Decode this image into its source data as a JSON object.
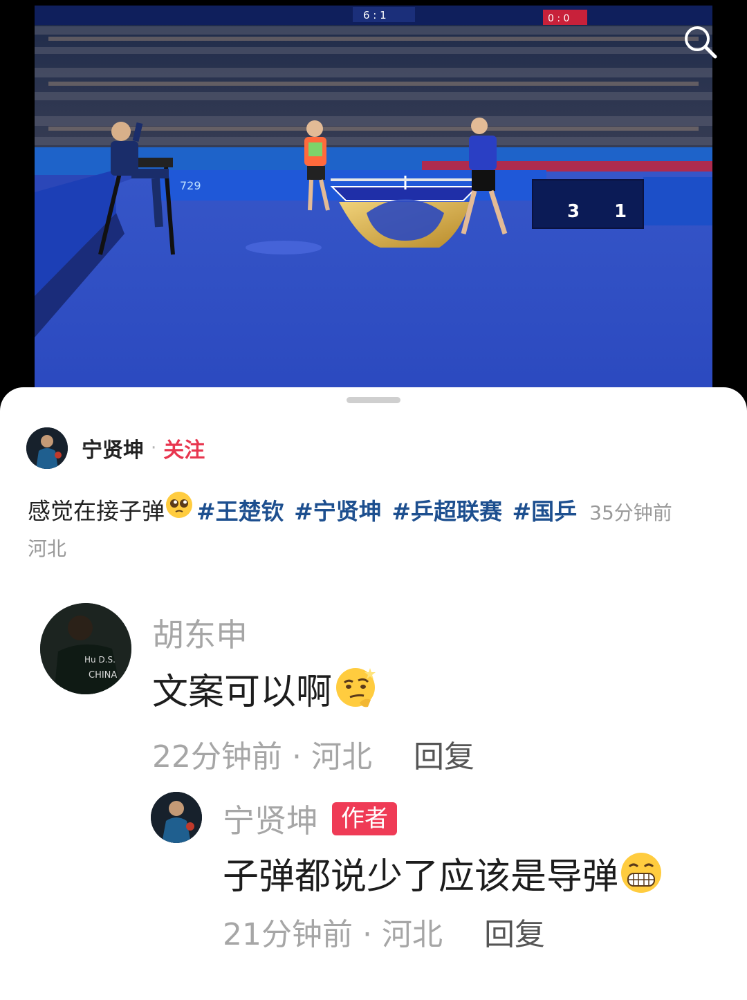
{
  "media": {
    "scoreboard_left": "3",
    "scoreboard_right": "1",
    "banner_top_score": "6 : 1",
    "banner_mid_score": "0 : 0",
    "sponsor_text": "729"
  },
  "post": {
    "username": "宁贤坤",
    "separator": "·",
    "follow_label": "关注",
    "caption_text": "感觉在接子弹",
    "hashtags": [
      "#王楚钦",
      "#宁贤坤",
      "#乒超联赛",
      "#国乒"
    ],
    "time": "35分钟前",
    "location": "河北"
  },
  "comments": [
    {
      "username": "胡东申",
      "text": "文案可以啊",
      "meta": "22分钟前 · 河北",
      "reply_label": "回复",
      "avatar_jersey_text": "Hu D.S.",
      "avatar_jersey_text2": "CHINA",
      "emoji_icon": "smirk-thinking-emoji"
    }
  ],
  "replies": [
    {
      "username": "宁贤坤",
      "badge": "作者",
      "text": "子弹都说少了应该是导弹",
      "meta": "21分钟前 · 河北",
      "reply_label": "回复",
      "emoji_icon": "grinning-teeth-emoji"
    }
  ],
  "colors": {
    "accent_red": "#e8364f",
    "hashtag_blue": "#1d4f8f",
    "badge_red": "#ef3b56",
    "court_blue": "#2f4fd0"
  },
  "icons": {
    "search": "search-icon"
  }
}
